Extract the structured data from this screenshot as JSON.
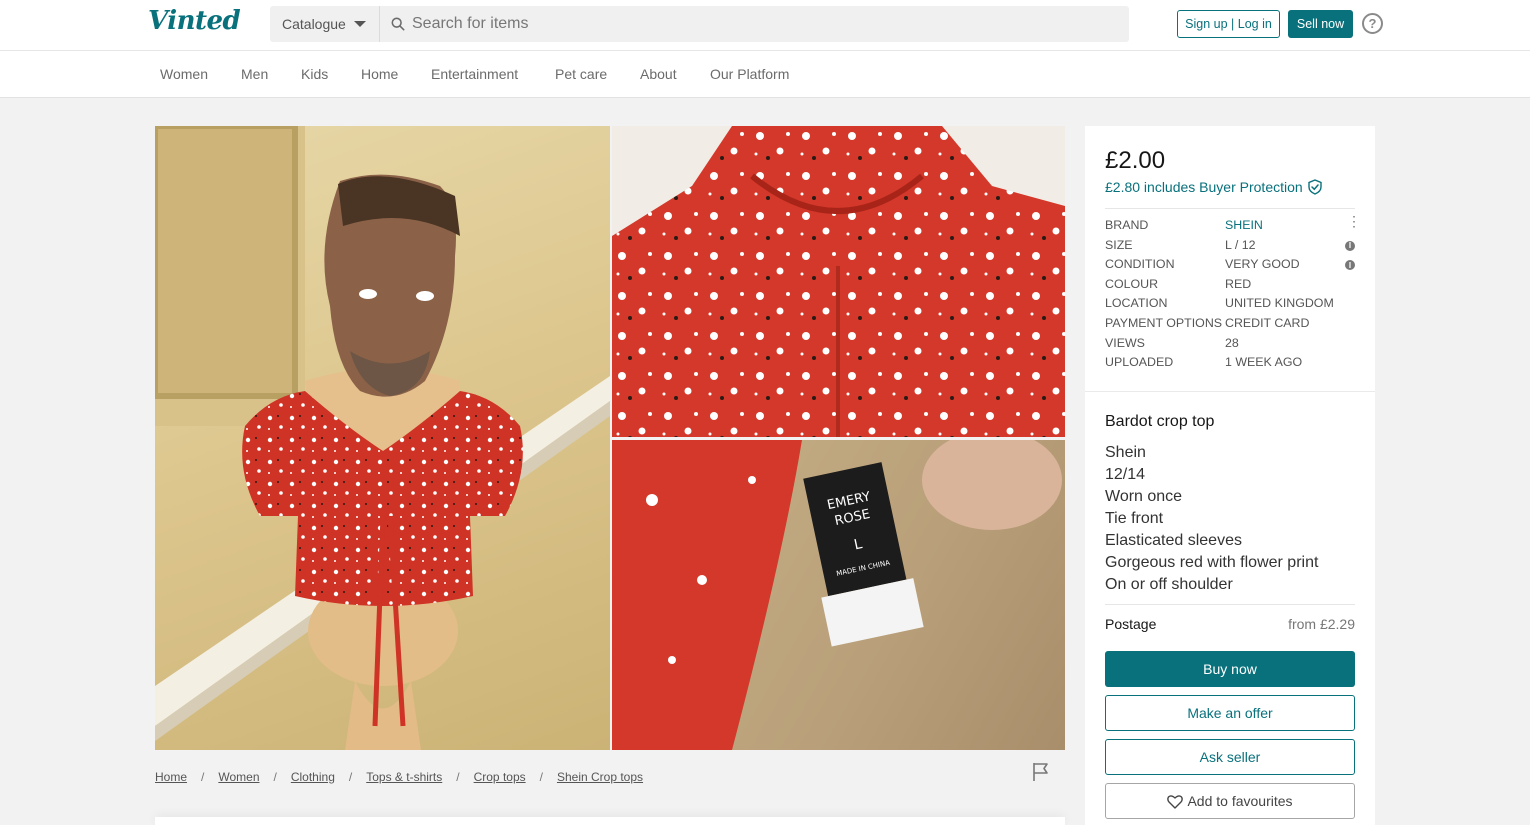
{
  "header": {
    "logo": "Vinted",
    "catalogue_label": "Catalogue",
    "search_placeholder": "Search for items",
    "signup_label": "Sign up | Log in",
    "sell_label": "Sell now",
    "help_glyph": "?"
  },
  "nav": {
    "items": [
      "Women",
      "Men",
      "Kids",
      "Home",
      "Entertainment",
      "Pet care",
      "About",
      "Our Platform"
    ]
  },
  "photos": {
    "main_label_1": "EMERY",
    "main_label_2": "ROSE",
    "tag_size": "L",
    "tag_made": "MADE IN CHINA"
  },
  "breadcrumb": [
    "Home",
    "Women",
    "Clothing",
    "Tops & t-shirts",
    "Crop tops",
    "Shein Crop tops"
  ],
  "item": {
    "price": "£2.00",
    "buyer_protection": "£2.80 includes Buyer Protection",
    "details": [
      {
        "key": "BRAND",
        "value": "SHEIN"
      },
      {
        "key": "SIZE",
        "value": "L / 12"
      },
      {
        "key": "CONDITION",
        "value": "VERY GOOD"
      },
      {
        "key": "COLOUR",
        "value": "RED"
      },
      {
        "key": "LOCATION",
        "value": "UNITED KINGDOM"
      },
      {
        "key": "PAYMENT OPTIONS",
        "value": "CREDIT CARD"
      },
      {
        "key": "VIEWS",
        "value": "28"
      },
      {
        "key": "UPLOADED",
        "value": "1 WEEK AGO"
      }
    ],
    "title": "Bardot crop top",
    "description": [
      "Shein",
      "12/14",
      "Worn once",
      "Tie front",
      "Elasticated sleeves",
      "Gorgeous red with flower print",
      "On or off shoulder"
    ],
    "postage_label": "Postage",
    "postage_value": "from £2.29",
    "buy_label": "Buy now",
    "offer_label": "Make an offer",
    "ask_label": "Ask seller",
    "fav_label": "Add to favourites"
  },
  "colors": {
    "brand": "#09717c",
    "dress_red": "#d3382a"
  },
  "icons": [
    "search-icon",
    "help-icon",
    "shield-check-icon",
    "more-icon",
    "info-icon",
    "flag-icon",
    "heart-icon"
  ]
}
